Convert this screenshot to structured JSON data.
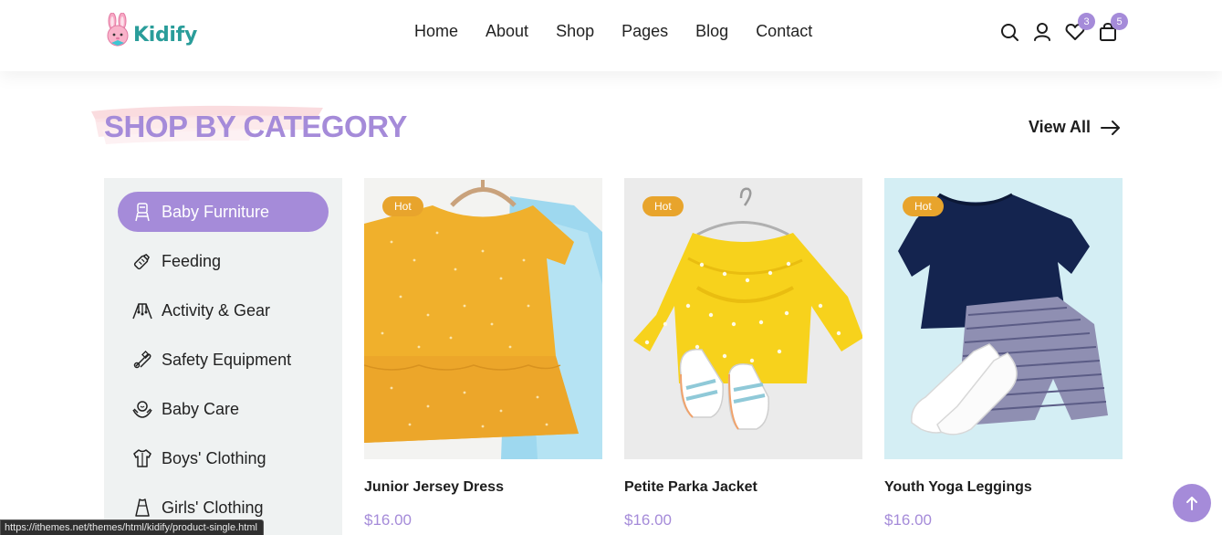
{
  "header": {
    "logo_text": "Kidify",
    "nav": [
      "Home",
      "About",
      "Shop",
      "Pages",
      "Blog",
      "Contact"
    ],
    "icons": [
      "search-icon",
      "user-icon",
      "heart-icon",
      "bag-icon"
    ],
    "wishlist_count": "3",
    "cart_count": "5"
  },
  "section": {
    "title": "SHOP BY CATEGORY",
    "view_all": "View All"
  },
  "categories": [
    {
      "label": "Baby Furniture",
      "icon": "high-chair-icon",
      "active": true
    },
    {
      "label": "Feeding",
      "icon": "feeding-bottle-icon",
      "active": false
    },
    {
      "label": "Activity & Gear",
      "icon": "activity-gym-icon",
      "active": false
    },
    {
      "label": "Safety Equipment",
      "icon": "safety-pin-icon",
      "active": false
    },
    {
      "label": "Baby Care",
      "icon": "baby-care-icon",
      "active": false
    },
    {
      "label": "Boys' Clothing",
      "icon": "shirt-icon",
      "active": false
    },
    {
      "label": "Girls' Clothing",
      "icon": "dress-icon",
      "active": false
    }
  ],
  "products": [
    {
      "name": "Junior Jersey Dress",
      "price": "$16.00",
      "badge": "Hot"
    },
    {
      "name": "Petite Parka Jacket",
      "price": "$16.00",
      "badge": "Hot"
    },
    {
      "name": "Youth Yoga Leggings",
      "price": "$16.00",
      "badge": "Hot"
    }
  ],
  "status_url": "https://ithemes.net/themes/html/kidify/product-single.html",
  "colors": {
    "accent": "#a58bd9",
    "hot_badge": "#e8a42c",
    "logo": "#2a9d9a",
    "sidebar_bg": "#eff2f2"
  }
}
